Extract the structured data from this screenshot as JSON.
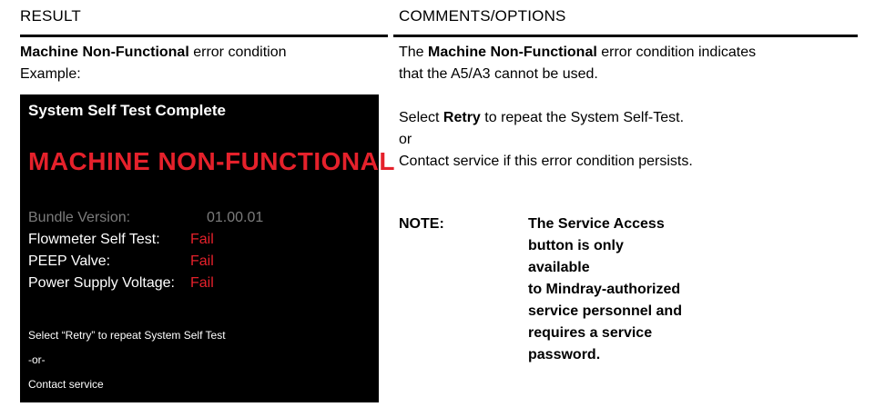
{
  "header": {
    "result": "RESULT",
    "comments": "COMMENTS/OPTIONS"
  },
  "result": {
    "bold": "Machine Non-Functional",
    "rest": " error condition",
    "line2": "Example:"
  },
  "screen": {
    "title": "System Self Test Complete",
    "big": "MACHINE NON-FUNCTIONAL",
    "rows": [
      {
        "label": "Bundle Version:",
        "value": "01.00.01"
      },
      {
        "label": "Flowmeter Self Test:",
        "value": "Fail"
      },
      {
        "label": "PEEP Valve:",
        "value": "Fail"
      },
      {
        "label": "Power Supply Voltage:",
        "value": "Fail"
      }
    ],
    "msg1": "Select “Retry” to repeat System Self Test",
    "msg2": "-or-",
    "msg3": "Contact service"
  },
  "comments": {
    "p1_pre": "The ",
    "p1_bold": "Machine Non-Functional",
    "p1_post": " error condition indicates",
    "p1_line2": "that the A5/A3 cannot be used.",
    "p2_pre": "Select ",
    "p2_bold": "Retry",
    "p2_post": " to repeat the System Self-Test.",
    "p3": "or",
    "p4": "Contact service if this error condition persists."
  },
  "note": {
    "label": "NOTE:",
    "lines": [
      "The Service Access",
      "button is only available",
      "to Mindray-authorized",
      "service personnel and",
      "requires a service",
      "password."
    ]
  },
  "colors": {
    "screen_bg": "#000000",
    "error_red": "#e5212b",
    "dim_gray": "#7c7c7c"
  }
}
